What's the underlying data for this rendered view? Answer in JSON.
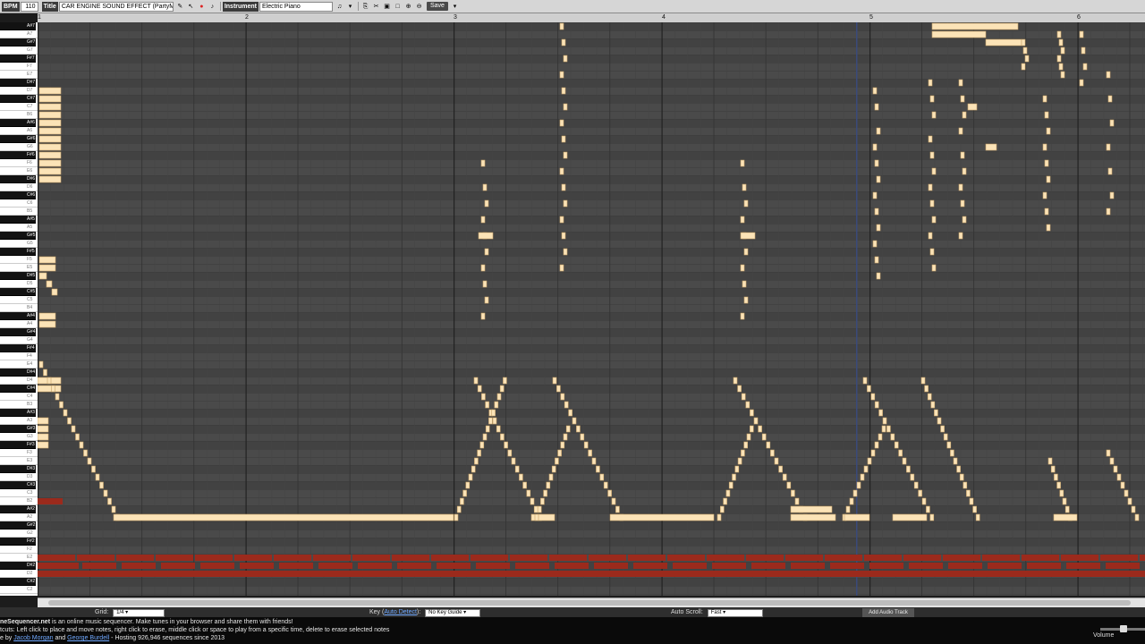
{
  "toolbar": {
    "bpm_label": "BPM",
    "bpm_value": "110",
    "title_label": "Title",
    "title_value": "CAR ENGINE SOUND EFFECT (PartyMusic",
    "instrument_label": "Instrument",
    "instrument_value": "Electric Piano",
    "save_label": "Save"
  },
  "ruler": {
    "measures": [
      "1",
      "2",
      "3",
      "4",
      "5",
      "6"
    ]
  },
  "piano_roll": {
    "note_color": "#fbe3b7",
    "other_track_color": "#9b2a1c",
    "grid_background": "#4a4a4a",
    "playhead_color": "#3a4a7a"
  },
  "keys": [
    "A#7",
    "A7",
    "G#7",
    "G7",
    "F#7",
    "F7",
    "E7",
    "D#7",
    "D7",
    "C#7",
    "C7",
    "B6",
    "A#6",
    "A6",
    "G#6",
    "G6",
    "F#6",
    "F6",
    "E6",
    "D#6",
    "D6",
    "C#6",
    "C6",
    "B5",
    "A#5",
    "A5",
    "G#5",
    "G5",
    "F#5",
    "F5",
    "E5",
    "D#5",
    "D5",
    "C#5",
    "C5",
    "B4",
    "A#4",
    "A4",
    "G#4",
    "G4",
    "F#4",
    "F4",
    "E4",
    "D#4",
    "D4",
    "C#4",
    "C4",
    "B3",
    "A#3",
    "A3",
    "G#3",
    "G3",
    "F#3",
    "F3",
    "E3",
    "D#3",
    "D3",
    "C#3",
    "C3",
    "B2",
    "A#2",
    "A2",
    "G#2",
    "G2",
    "F#2",
    "F2",
    "E2",
    "D#2",
    "D2",
    "C#2",
    "C2"
  ],
  "bottom": {
    "grid_label": "Grid:",
    "grid_value": "1/4",
    "key_label": "Key",
    "auto_detect": "Auto Detect",
    "key_value": "No Key Guide",
    "autoscroll_label": "Auto Scroll:",
    "autoscroll_value": "Fast",
    "add_audio": "Add Audio Track"
  },
  "footer": {
    "line1_site": "neSequencer.net",
    "line1_rest": " is an online music sequencer. Make tunes in your browser and share them with friends!",
    "line2": "tcuts: Left click to place and move notes, right click to erase, middle click or space to play from a specific time, delete to erase selected notes",
    "line3_pre": "e by ",
    "author1": "Jacob Morgan",
    "line3_and": " and ",
    "author2": "George Burdell",
    "line3_rest": " - Hosting 926,946 sequences since 2013",
    "volume_label": "Volume"
  }
}
